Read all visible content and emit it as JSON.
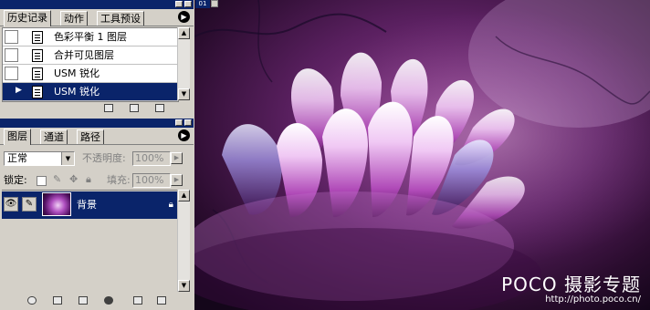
{
  "history_panel": {
    "tabs": [
      "历史记录",
      "动作",
      "工具预设"
    ],
    "items": [
      {
        "label": "色彩平衡 1 图层",
        "selected": false
      },
      {
        "label": "合并可见图层",
        "selected": false
      },
      {
        "label": "USM 锐化",
        "selected": false
      },
      {
        "label": "USM 锐化",
        "selected": true
      }
    ]
  },
  "layers_panel": {
    "tabs": [
      "图层",
      "通道",
      "路径"
    ],
    "blend_mode": "正常",
    "opacity_label": "不透明度:",
    "opacity_value": "100%",
    "lock_label": "锁定:",
    "fill_label": "填充:",
    "fill_value": "100%",
    "layers": [
      {
        "name": "背景",
        "selected": true,
        "locked": true
      }
    ]
  },
  "canvas": {
    "tab_label": "01",
    "watermark_brand": "POCO 摄影专题",
    "watermark_url": "http://photo.poco.cn/"
  },
  "colors": {
    "selection": "#0a246a",
    "panel_bg": "#d4d0c8",
    "image_dark": "#2a0d2e",
    "image_accent": "#c060d0"
  }
}
